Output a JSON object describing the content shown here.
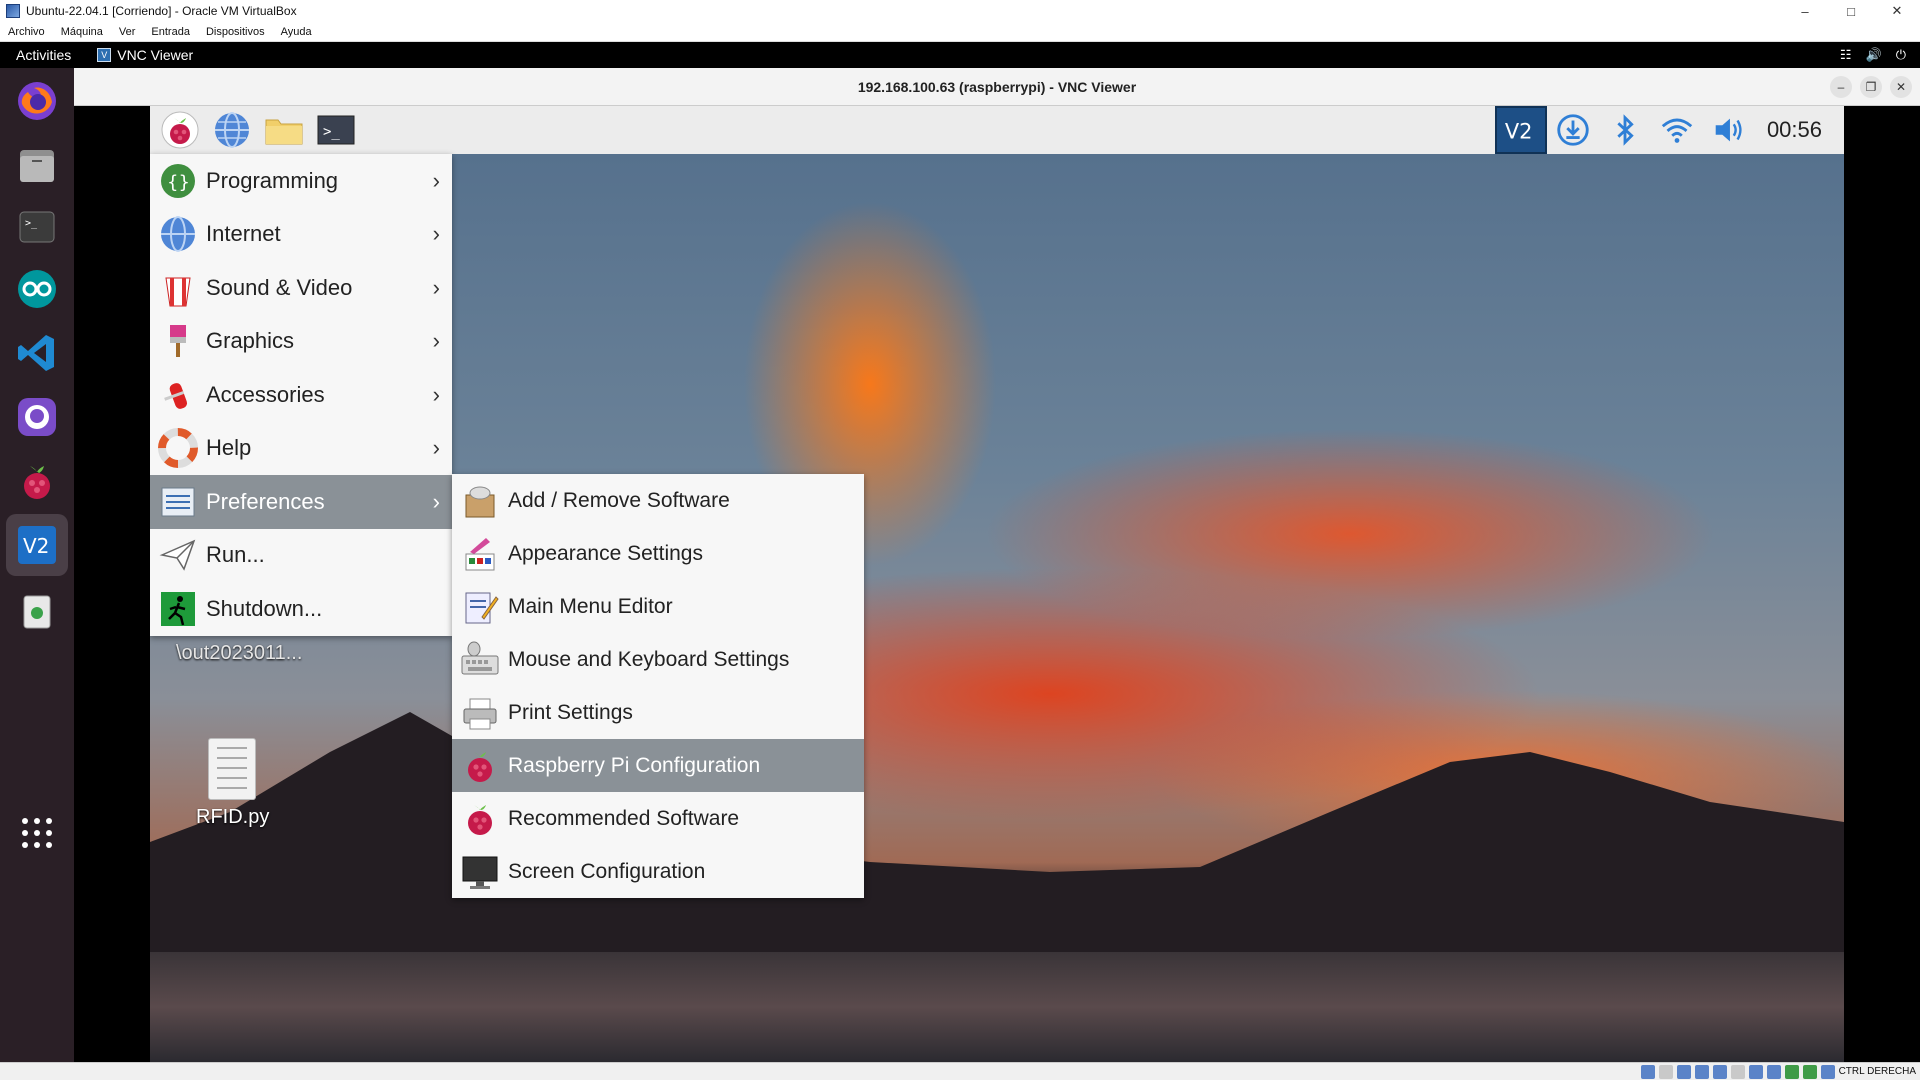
{
  "vbox": {
    "title": "Ubuntu-22.04.1 [Corriendo] - Oracle VM VirtualBox",
    "menu": [
      "Archivo",
      "Máquina",
      "Ver",
      "Entrada",
      "Dispositivos",
      "Ayuda"
    ],
    "status_text": "CTRL DERECHA"
  },
  "ubuntu": {
    "activities": "Activities",
    "app_name": "VNC Viewer",
    "dock": [
      "firefox-icon",
      "files-icon",
      "terminal-icon",
      "arduino-icon",
      "vscode-icon",
      "github-icon",
      "raspberry-icon",
      "vnc-viewer-icon",
      "trash-icon",
      "show-apps-icon"
    ]
  },
  "vnc": {
    "window_title": "192.168.100.63 (raspberrypi) - VNC Viewer"
  },
  "pi": {
    "clock": "00:56",
    "desktop": {
      "folder_label": "\\out2023011...",
      "file_label": "RFID.py"
    },
    "main_menu": [
      {
        "label": "Programming",
        "icon": "programming-icon"
      },
      {
        "label": "Internet",
        "icon": "globe-icon"
      },
      {
        "label": "Sound & Video",
        "icon": "popcorn-icon"
      },
      {
        "label": "Graphics",
        "icon": "paintbrush-icon"
      },
      {
        "label": "Accessories",
        "icon": "knife-icon"
      },
      {
        "label": "Help",
        "icon": "lifebuoy-icon"
      },
      {
        "label": "Preferences",
        "icon": "preferences-icon"
      },
      {
        "label": "Run...",
        "icon": "paper-plane-icon"
      },
      {
        "label": "Shutdown...",
        "icon": "exit-icon"
      }
    ],
    "preferences_menu": [
      {
        "label": "Add / Remove Software",
        "icon": "package-icon"
      },
      {
        "label": "Appearance Settings",
        "icon": "palette-icon"
      },
      {
        "label": "Main Menu Editor",
        "icon": "pencil-icon"
      },
      {
        "label": "Mouse and Keyboard Settings",
        "icon": "keyboard-icon"
      },
      {
        "label": "Print Settings",
        "icon": "printer-icon"
      },
      {
        "label": "Raspberry Pi Configuration",
        "icon": "raspberry-icon"
      },
      {
        "label": "Recommended Software",
        "icon": "raspberry-icon"
      },
      {
        "label": "Screen Configuration",
        "icon": "monitor-icon"
      }
    ]
  },
  "colors": {
    "menu_highlight": "#8a9197",
    "ubuntu_dock": "#2a1f26",
    "vnc_tray": "#1d4f86"
  }
}
